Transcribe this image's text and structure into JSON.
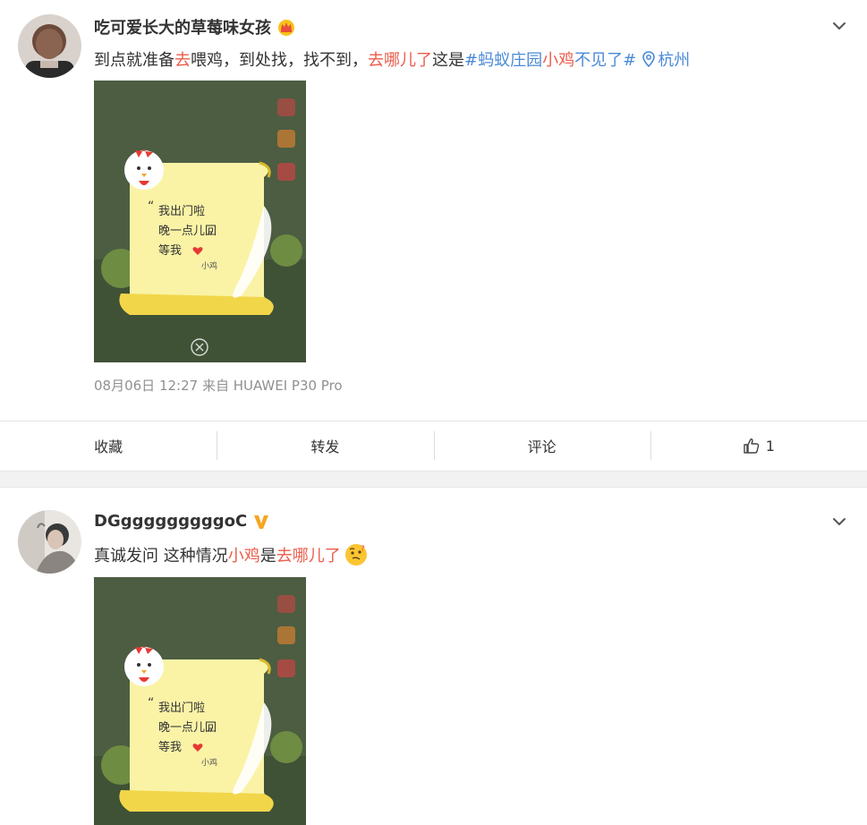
{
  "posts": [
    {
      "username": "吃可爱长大的草莓味女孩",
      "badge_icon": "crown-icon",
      "content": {
        "part1": "到点就准备",
        "part2": "去",
        "part3": "喂鸡，到处找，找不到，",
        "part4": "去哪儿了",
        "part5": "这是",
        "part6": "#蚂蚁庄园",
        "part7": "小鸡",
        "part8": "不见了#",
        "location": "杭州"
      },
      "image": {
        "note_line1": "我出门啦",
        "note_line2": "晚一点儿回",
        "note_line3": "等我",
        "signature": "小鸡"
      },
      "meta": "08月06日 12:27  来自 HUAWEI P30 Pro",
      "actions": {
        "favorite": "收藏",
        "repost": "转发",
        "comment": "评论",
        "like_count": "1"
      }
    },
    {
      "username": "DGgggggggggoC",
      "badge_icon": "verified-v-icon",
      "content": {
        "part1": "真诚发问 这种情况",
        "part2": "小鸡",
        "part3": "是",
        "part4": "去哪儿了",
        "emoji": "thinking-face-icon"
      },
      "image": {
        "note_line1": "我出门啦",
        "note_line2": "晚一点儿回",
        "note_line3": "等我",
        "signature": "小鸡"
      }
    }
  ],
  "colors": {
    "highlight_red": "#eb5c4a",
    "link_blue": "#4a8ad6",
    "meta_gray": "#909090"
  }
}
